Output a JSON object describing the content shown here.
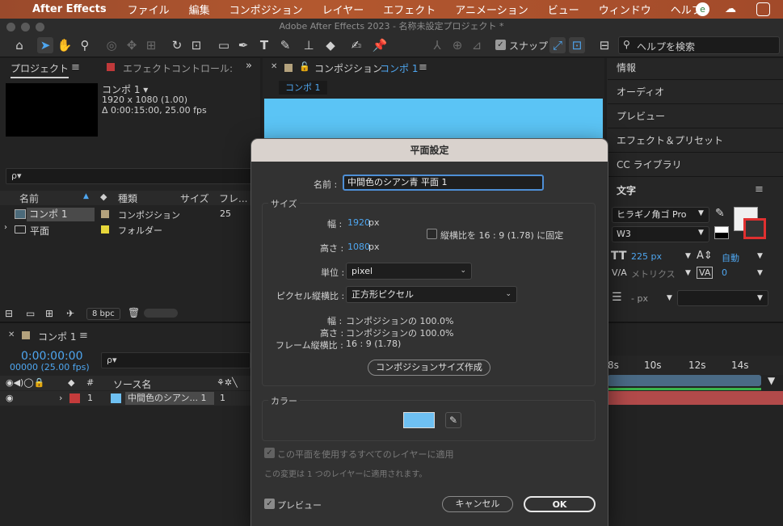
{
  "menubar": {
    "app": "After Effects",
    "items": [
      "ファイル",
      "編集",
      "コンポジション",
      "レイヤー",
      "エフェクト",
      "アニメーション",
      "ビュー",
      "ウィンドウ",
      "ヘルプ"
    ]
  },
  "window": {
    "title": "Adobe After Effects 2023 - 名称未設定プロジェクト *"
  },
  "toolbar": {
    "snap_label": "スナップ",
    "help_placeholder": "ヘルプを検索"
  },
  "project": {
    "tab": "プロジェクト",
    "tab2": "エフェクトコントロール: ",
    "comp_name": "コンポ 1 ▾",
    "resolution": "1920 x 1080 (1.00)",
    "duration": "Δ 0:00:15:00, 25.00 fps",
    "search_placeholder": "ρ▾",
    "columns": {
      "name": "名前",
      "type": "種類",
      "size": "サイズ",
      "frame": "フレ..."
    },
    "rows": [
      {
        "name": "コンポ 1",
        "type": "コンポジション",
        "size": "25"
      },
      {
        "name": "平面",
        "type": "フォルダー",
        "size": ""
      }
    ],
    "bpc": "8 bpc"
  },
  "comp": {
    "tab_prefix": "コンポジション",
    "tab_name": "コンポ 1",
    "chip": "コンポ 1"
  },
  "right_panels": {
    "items": [
      "情報",
      "オーディオ",
      "プレビュー",
      "エフェクト＆プリセット",
      "CC ライブラリ"
    ],
    "text_header": "文字",
    "font": "ヒラギノ角ゴ Pro",
    "weight": "W3",
    "font_size": "225 px",
    "leading": "自動",
    "kerning": "メトリクス",
    "tracking": "0",
    "stroke": "- px"
  },
  "timeline": {
    "tab": "コンポ 1",
    "timecode": "0:00:00:00",
    "frames": "00000 (25.00 fps)",
    "search_placeholder": "ρ▾",
    "col_source": "ソース名",
    "col_hash": "#",
    "layer_num": "1",
    "layer_name": "中間色のシアン... 1",
    "layer_parent": "1",
    "ruler": [
      "8s",
      "10s",
      "12s",
      "14s"
    ],
    "track_color": "#b24a4a"
  },
  "dialog": {
    "title": "平面設定",
    "name_label": "名前 :",
    "name_value": "中間色のシアン青 平面 1",
    "size_legend": "サイズ",
    "width_label": "幅 :",
    "width_value": "1920",
    "width_unit": "px",
    "height_label": "高さ :",
    "height_value": "1080",
    "height_unit": "px",
    "lock_label": "縦横比を 16 : 9 (1.78) に固定",
    "unit_label": "単位 :",
    "unit_value": "pixel",
    "par_label": "ピクセル縦横比 :",
    "par_value": "正方形ピクセル",
    "info_width_label": "幅 :",
    "info_width_value": "コンポジションの 100.0%",
    "info_height_label": "高さ :",
    "info_height_value": "コンポジションの 100.0%",
    "info_frame_label": "フレーム縦横比 :",
    "info_frame_value": "16 : 9 (1.78)",
    "make_comp_size": "コンポジションサイズ作成",
    "color_legend": "カラー",
    "swatch_color": "#6ec0f2",
    "apply_label": "この平面を使用するすべてのレイヤーに適用",
    "note": "この変更は 1 つのレイヤーに適用されます。",
    "preview_label": "プレビュー",
    "cancel": "キャンセル",
    "ok": "OK"
  }
}
